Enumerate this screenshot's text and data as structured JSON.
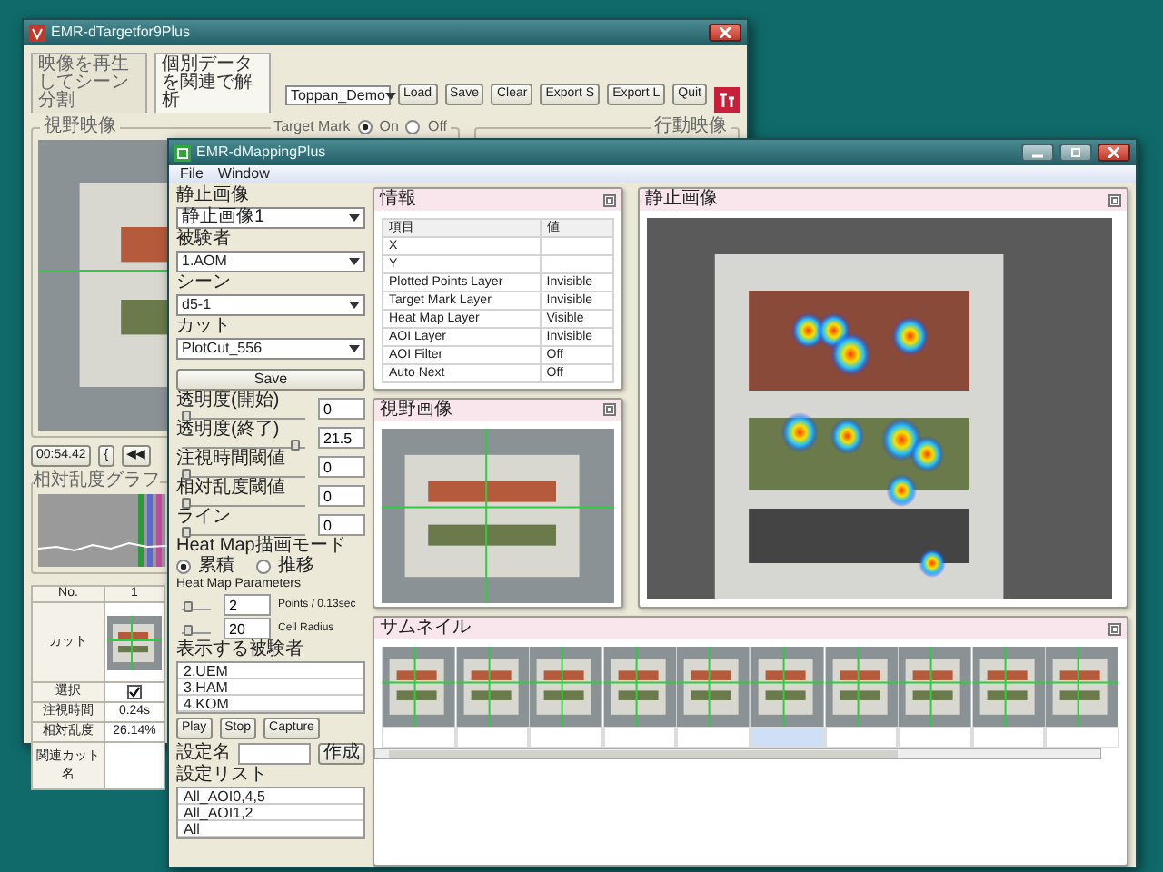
{
  "back_window": {
    "title": "EMR-dTargetfor9Plus",
    "tabs": [
      {
        "label": "映像を再生してシーン分割",
        "selected": false
      },
      {
        "label": "個別データを関連で解析",
        "selected": true
      }
    ],
    "project": "Toppan_Demo",
    "buttons": [
      "Load",
      "Save",
      "Clear",
      "Export S",
      "Export L",
      "Quit"
    ],
    "view_group": {
      "title": "視野映像",
      "target_mark_label": "Target Mark",
      "options": [
        {
          "label": "On",
          "selected": true
        },
        {
          "label": "Off",
          "selected": false
        }
      ]
    },
    "action_group": {
      "title": "行動映像"
    },
    "timecode": "00:54.42",
    "nav_buttons": [
      "{",
      "◀◀"
    ],
    "graph_title": "相対乱度グラフ",
    "table": {
      "columns": [
        "No.",
        "1"
      ],
      "rows": [
        {
          "label": "カット",
          "kind": "image"
        },
        {
          "label": "選択",
          "kind": "check",
          "checked": true
        },
        {
          "label": "注視時間",
          "kind": "text",
          "value": "0.24s"
        },
        {
          "label": "相対乱度",
          "kind": "text",
          "value": "26.14%"
        },
        {
          "label": "関連カット名",
          "kind": "text"
        }
      ]
    }
  },
  "front_window": {
    "title": "EMR-dMappingPlus",
    "menu": [
      "File",
      "Window"
    ],
    "selectors": [
      {
        "label": "静止画像",
        "value": "静止画像1"
      },
      {
        "label": "被験者",
        "value": "1.AOM"
      },
      {
        "label": "シーン",
        "value": "d5-1"
      },
      {
        "label": "カット",
        "value": "PlotCut_556"
      }
    ],
    "save_button": "Save",
    "sliders": [
      {
        "label": "透明度(開始)",
        "value": "0",
        "level": 0
      },
      {
        "label": "透明度(終了)",
        "value": "21.5",
        "level": 0.95
      },
      {
        "label": "注視時間閾値",
        "value": "0",
        "level": 0
      },
      {
        "label": "相対乱度閾値",
        "value": "0",
        "level": 0
      },
      {
        "label": "ライン",
        "value": "0",
        "level": 0
      }
    ],
    "heatmap_mode": {
      "title": "Heat Map描画モード",
      "options": [
        {
          "label": "累積",
          "selected": true
        },
        {
          "label": "推移",
          "selected": false
        }
      ]
    },
    "heatmap_params": {
      "title": "Heat Map Parameters",
      "rows": [
        {
          "value": "2",
          "unit": "Points / 0.13sec",
          "level": 0.1
        },
        {
          "value": "20",
          "unit": "Cell Radius",
          "level": 0.1
        }
      ]
    },
    "subjects": {
      "title": "表示する被験者",
      "items": [
        "2.UEM",
        "3.HAM",
        "4.KOM"
      ]
    },
    "playback_buttons": [
      "Play",
      "Stop",
      "Capture"
    ],
    "setting_name": {
      "label": "設定名",
      "button": "作成"
    },
    "setting_list": {
      "label": "設定リスト",
      "items": [
        "All_AOI0,4,5",
        "All_AOI1,2",
        "All"
      ]
    },
    "info_panel": {
      "title": "情報",
      "columns": [
        "項目",
        "値"
      ],
      "rows": [
        {
          "item": "X"
        },
        {
          "item": "Y"
        },
        {
          "item": "Plotted Points Layer",
          "value": "Invisible"
        },
        {
          "item": "Target Mark Layer",
          "value": "Invisible"
        },
        {
          "item": "Heat Map Layer",
          "value": "Visible"
        },
        {
          "item": "AOI Layer",
          "value": "Invisible"
        },
        {
          "item": "AOI Filter",
          "value": "Off"
        },
        {
          "item": "Auto Next",
          "value": "Off"
        }
      ]
    },
    "view_panel": {
      "title": "視野画像"
    },
    "still_panel": {
      "title": "静止画像"
    },
    "thumbnail_panel": {
      "title": "サムネイル",
      "thumbnails": [
        {
          "selected": false
        },
        {
          "selected": false
        },
        {
          "selected": false
        },
        {
          "selected": false
        },
        {
          "selected": false
        },
        {
          "selected": true
        },
        {
          "selected": false
        },
        {
          "selected": false
        },
        {
          "selected": false
        },
        {
          "selected": false
        }
      ]
    }
  }
}
